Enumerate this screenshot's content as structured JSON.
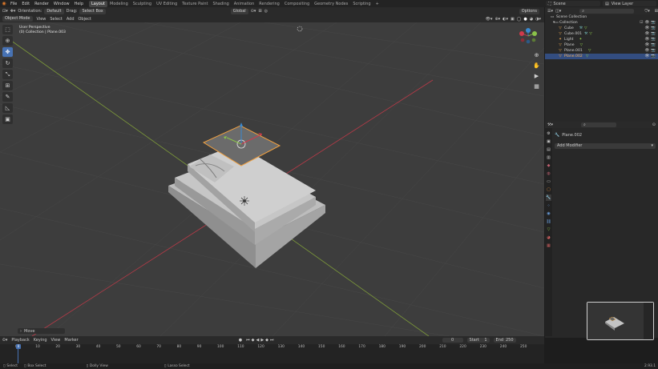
{
  "menubar": {
    "items": [
      "File",
      "Edit",
      "Render",
      "Window",
      "Help"
    ],
    "workspaces": [
      "Layout",
      "Modeling",
      "Sculpting",
      "UV Editing",
      "Texture Paint",
      "Shading",
      "Animation",
      "Rendering",
      "Compositing",
      "Geometry Nodes",
      "Scripting"
    ],
    "active_workspace": "Layout",
    "add_tab": "+",
    "scene": "Scene",
    "view_layer": "View Layer"
  },
  "toolheader": {
    "orientation_label": "Orientation:",
    "orientation_value": "Default",
    "drag_label": "Drag:",
    "drag_value": "Select Box",
    "transform_orientation": "Global",
    "options": "Options"
  },
  "viewport_header": {
    "mode": "Object Mode",
    "menus": [
      "View",
      "Select",
      "Add",
      "Object"
    ]
  },
  "viewport": {
    "view_name": "User Perspective",
    "collection_info": "(0) Collection | Plane.003",
    "gizmo_axes": [
      "X",
      "Y",
      "Z"
    ]
  },
  "outliner": {
    "root": "Scene Collection",
    "collection": "Collection",
    "items": [
      {
        "name": "Cube",
        "icon": "mesh-icon",
        "selected": false
      },
      {
        "name": "Cube.001",
        "icon": "mesh-icon",
        "selected": false
      },
      {
        "name": "Light",
        "icon": "light-icon",
        "selected": false
      },
      {
        "name": "Plane",
        "icon": "mesh-icon",
        "selected": false
      },
      {
        "name": "Plane.001",
        "icon": "mesh-icon",
        "selected": false
      },
      {
        "name": "Plane.002",
        "icon": "mesh-icon",
        "selected": true
      }
    ]
  },
  "properties": {
    "object_name": "Plane.002",
    "add_modifier": "Add Modifier"
  },
  "last_operator": "Move",
  "timeline": {
    "menus": [
      "Playback",
      "Keying",
      "View",
      "Marker"
    ],
    "current_frame": "0",
    "start_label": "Start",
    "start_value": "1",
    "end_label": "End",
    "end_value": "250",
    "ticks": [
      "0",
      "10",
      "20",
      "30",
      "40",
      "50",
      "60",
      "70",
      "80",
      "90",
      "100",
      "110",
      "120",
      "130",
      "140",
      "150",
      "160",
      "170",
      "180",
      "190",
      "200",
      "210",
      "220",
      "230",
      "240",
      "250"
    ],
    "playhead_label": "0"
  },
  "statusbar": {
    "select": "Select",
    "box_select": "Box Select",
    "dolly_view": "Dolly View",
    "lasso_select": "Lasso Select",
    "version": "2.93.1"
  },
  "colors": {
    "accent": "#4772b3",
    "selection_orange": "#f0a040",
    "axis_x": "#d03a4c",
    "axis_y": "#8bc34a",
    "axis_z": "#3a8ad0"
  }
}
